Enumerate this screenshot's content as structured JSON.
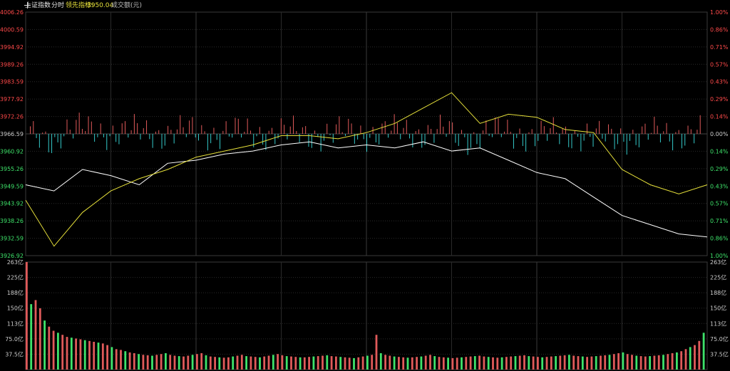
{
  "header": {
    "index_name": "上证指数",
    "mode": "分时",
    "lead_label": "领先指标:",
    "lead_value": "3950.04",
    "volume_label": "成交额(元)"
  },
  "colors": {
    "up": "#e05a5a",
    "down": "#34c8c8",
    "up_text": "#ff4a4a",
    "down_text": "#3ee36a",
    "neutral_text": "#cccccc",
    "index_line": "#ffffff",
    "lead_line": "#e6e03a",
    "grid": "#2a2a2a",
    "vol_up": "#e05a5a",
    "vol_down": "#3ee36a"
  },
  "chart_data": [
    {
      "type": "line",
      "x": [
        0,
        10,
        20,
        30,
        40,
        50,
        60,
        70,
        80,
        90,
        100,
        110,
        120,
        130,
        140,
        150,
        160,
        170,
        180,
        190,
        200,
        210,
        220,
        230,
        240
      ],
      "series": [
        {
          "name": "上证指数",
          "values": [
            3950,
            3948,
            3955,
            3953,
            3950,
            3957,
            3958,
            3960,
            3961,
            3963,
            3964,
            3962,
            3963,
            3962,
            3964,
            3961,
            3962,
            3958,
            3954,
            3952,
            3946,
            3940,
            3937,
            3934,
            3933
          ]
        },
        {
          "name": "领先指标",
          "values": [
            3945,
            3930,
            3941,
            3948,
            3952,
            3955,
            3959,
            3961,
            3963,
            3966,
            3966,
            3965,
            3967,
            3970,
            3975,
            3980,
            3970,
            3973,
            3972,
            3968,
            3967,
            3955,
            3950,
            3947,
            3950
          ]
        }
      ],
      "y_ticks_left": [
        "4006.26",
        "4000.59",
        "3994.92",
        "3989.26",
        "3983.59",
        "3977.92",
        "3972.26",
        "3966.59",
        "3960.92",
        "3955.26",
        "3949.59",
        "3943.92",
        "3938.26",
        "3932.59",
        "3926.92"
      ],
      "y_ticks_right": [
        "1.00%",
        "0.86%",
        "0.71%",
        "0.57%",
        "0.43%",
        "0.29%",
        "0.14%",
        "0.00%",
        "0.14%",
        "0.29%",
        "0.43%",
        "0.57%",
        "0.71%",
        "0.86%",
        "1.00%"
      ],
      "ylim": [
        3926.92,
        4006.26
      ],
      "baseline": 3966.59,
      "xlim": [
        0,
        240
      ],
      "grid": true
    },
    {
      "type": "bar",
      "title": "成交额(元)",
      "values": [
        263,
        160,
        170,
        150,
        120,
        105,
        95,
        90,
        85,
        80,
        78,
        76,
        74,
        72,
        70,
        68,
        66,
        64,
        60,
        55,
        50,
        48,
        45,
        42,
        40,
        38,
        36,
        35,
        34,
        36,
        38,
        40,
        36,
        34,
        33,
        32,
        34,
        36,
        38,
        40,
        35,
        32,
        31,
        30,
        29,
        30,
        32,
        34,
        36,
        33,
        32,
        31,
        30,
        32,
        34,
        36,
        38,
        35,
        33,
        32,
        31,
        30,
        30,
        31,
        32,
        33,
        34,
        35,
        33,
        32,
        31,
        30,
        29,
        28,
        30,
        32,
        34,
        36,
        85,
        40,
        36,
        34,
        32,
        31,
        30,
        29,
        30,
        31,
        32,
        34,
        36,
        33,
        31,
        30,
        29,
        28,
        29,
        30,
        31,
        32,
        33,
        34,
        32,
        31,
        30,
        29,
        30,
        31,
        32,
        33,
        34,
        35,
        33,
        32,
        31,
        30,
        31,
        32,
        33,
        34,
        35,
        36,
        34,
        33,
        32,
        31,
        32,
        33,
        34,
        35,
        36,
        38,
        40,
        42,
        38,
        36,
        34,
        33,
        32,
        33,
        34,
        35,
        36,
        38,
        40,
        42,
        45,
        50,
        55,
        60,
        70,
        90
      ],
      "y_ticks": [
        "263亿",
        "225亿",
        "188亿",
        "150亿",
        "113亿",
        "75.0亿",
        "37.5亿"
      ],
      "ylim": [
        0,
        263
      ],
      "grid": true
    }
  ]
}
